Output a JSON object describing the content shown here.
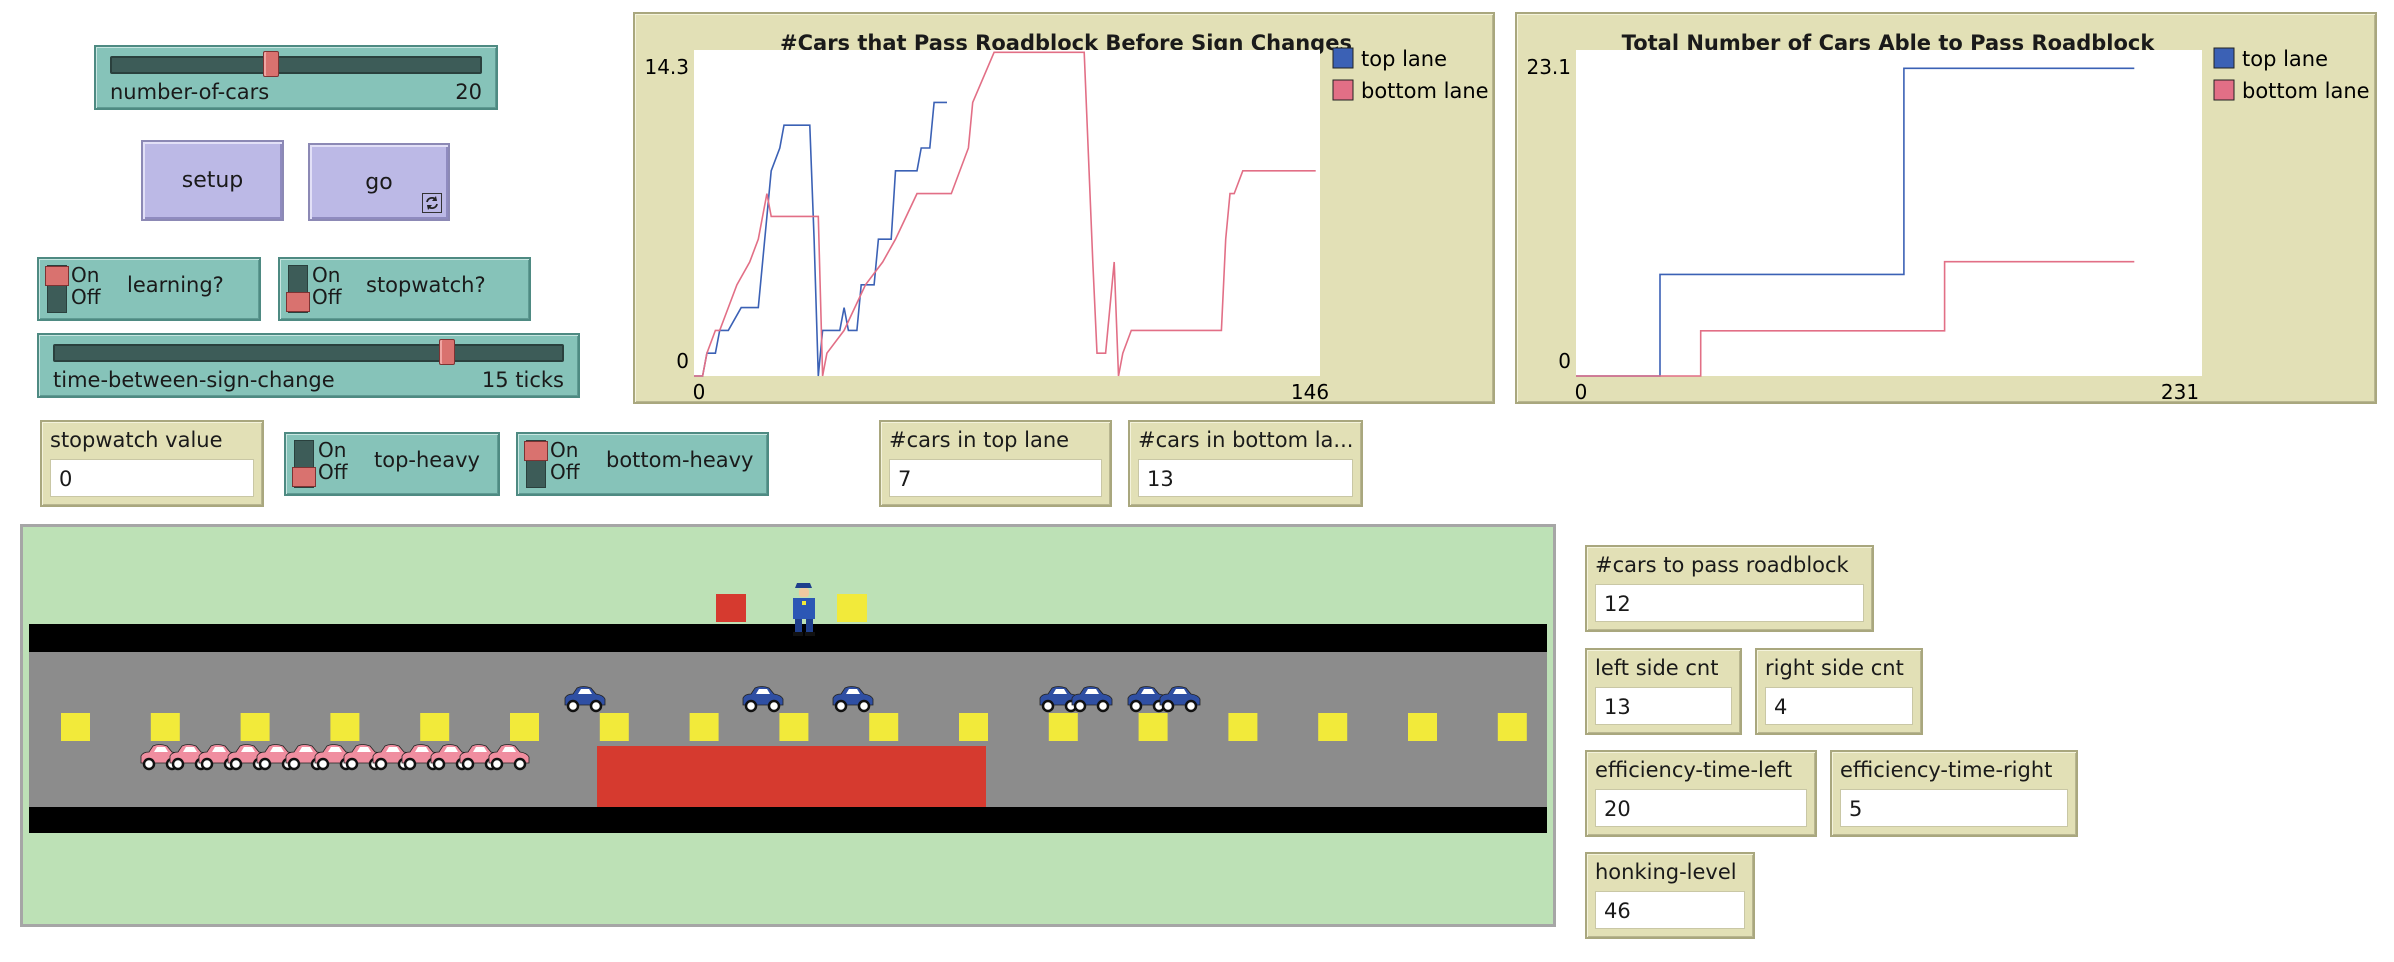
{
  "sliders": {
    "number_of_cars": {
      "label": "number-of-cars",
      "value": "20",
      "fraction": 0.43
    },
    "time_between": {
      "label": "time-between-sign-change",
      "value": "15 ticks",
      "fraction": 0.77
    }
  },
  "buttons": {
    "setup": "setup",
    "go": "go",
    "go_icon": "forever-loop-icon"
  },
  "switches": {
    "on_text": "On",
    "off_text": "Off",
    "learning": {
      "label": "learning?",
      "on": true
    },
    "stopwatch": {
      "label": "stopwatch?",
      "on": false
    },
    "top_heavy": {
      "label": "top-heavy",
      "on": false
    },
    "bottom_heavy": {
      "label": "bottom-heavy",
      "on": true
    }
  },
  "monitors": {
    "stopwatch_value": {
      "label": "stopwatch value",
      "value": "0"
    },
    "cars_top": {
      "label": "#cars in top lane",
      "value": "7"
    },
    "cars_bottom": {
      "label": "#cars in bottom la...",
      "value": "13"
    },
    "cars_pass": {
      "label": "#cars to pass roadblock",
      "value": "12"
    },
    "left_cnt": {
      "label": "left side cnt",
      "value": "13"
    },
    "right_cnt": {
      "label": "right side cnt",
      "value": "4"
    },
    "eff_left": {
      "label": "efficiency-time-left",
      "value": "20"
    },
    "eff_right": {
      "label": "efficiency-time-right",
      "value": "5"
    },
    "honking": {
      "label": "honking-level",
      "value": "46"
    }
  },
  "colors": {
    "top_lane": "#3b61b5",
    "bottom_lane": "#e26f86",
    "plot_bg": "#e2e0b6",
    "grass": "#bde1b6",
    "road": "#8c8c8c",
    "roadblock": "#d63a2f",
    "marker": "#f2ea3a",
    "car_top": "#2f4fa3",
    "car_bottom": "#f08ea0"
  },
  "chart_data": [
    {
      "type": "line",
      "title": "#Cars that Pass Roadblock Before Sign Changes",
      "xlim": [
        0,
        146
      ],
      "ylim": [
        0,
        14.3
      ],
      "x_tick_labels": [
        "0",
        "146"
      ],
      "y_tick_labels": [
        "0",
        "14.3"
      ],
      "legend": "top-right",
      "series": [
        {
          "name": "top lane",
          "x": [
            0,
            2,
            3,
            5,
            6,
            8,
            11,
            15,
            16,
            17,
            18,
            20,
            21,
            25,
            27,
            28,
            29,
            30,
            34,
            35,
            36,
            38,
            39,
            42,
            43,
            46,
            47,
            52,
            53,
            55,
            56,
            59
          ],
          "y": [
            0,
            0,
            1,
            1,
            2,
            2,
            3,
            3,
            5,
            7,
            9,
            10,
            11,
            11,
            11,
            6,
            0,
            2,
            2,
            3,
            2,
            2,
            4,
            4,
            6,
            6,
            9,
            9,
            10,
            10,
            12,
            12
          ]
        },
        {
          "name": "bottom lane",
          "x": [
            0,
            2,
            3,
            5,
            6,
            8,
            10,
            13,
            15,
            16,
            17,
            18,
            19,
            20,
            25,
            29,
            30,
            31,
            35,
            40,
            44,
            47,
            52,
            55,
            56,
            60,
            64,
            65,
            70,
            72,
            73,
            85,
            91,
            93,
            94,
            96,
            98,
            99,
            100,
            102,
            110,
            112,
            113,
            117,
            118,
            121,
            123,
            124,
            125,
            126,
            128,
            130,
            145
          ],
          "y": [
            0,
            0,
            1,
            2,
            2,
            3,
            4,
            5,
            6,
            7,
            8,
            7,
            7,
            7,
            7,
            7,
            0,
            1,
            2,
            4,
            5,
            6,
            8,
            8,
            8,
            8,
            10,
            12,
            14.2,
            14.2,
            14.2,
            14.2,
            14.2,
            5,
            1,
            1,
            5,
            0,
            1,
            2,
            2,
            2,
            2,
            2,
            2,
            2,
            2,
            6,
            8,
            8,
            9,
            9,
            9
          ]
        }
      ]
    },
    {
      "type": "line",
      "title": "Total Number of Cars Able to Pass Roadblock",
      "xlim": [
        0,
        231
      ],
      "ylim": [
        0,
        23.1
      ],
      "x_tick_labels": [
        "0",
        "231"
      ],
      "y_tick_labels": [
        "0",
        "23.1"
      ],
      "legend": "top-right",
      "series": [
        {
          "name": "top lane",
          "x": [
            0,
            31,
            31,
            121,
            121,
            206
          ],
          "y": [
            0,
            0,
            7.2,
            7.2,
            21.8,
            21.8
          ]
        },
        {
          "name": "bottom lane",
          "x": [
            0,
            46,
            46,
            136,
            136,
            206
          ],
          "y": [
            0,
            0,
            3.2,
            3.2,
            8.1,
            8.1
          ]
        }
      ]
    }
  ],
  "world": {
    "top_cars_count": 7,
    "bottom_cars_count": 13,
    "officer_icon": "police-officer-icon"
  }
}
